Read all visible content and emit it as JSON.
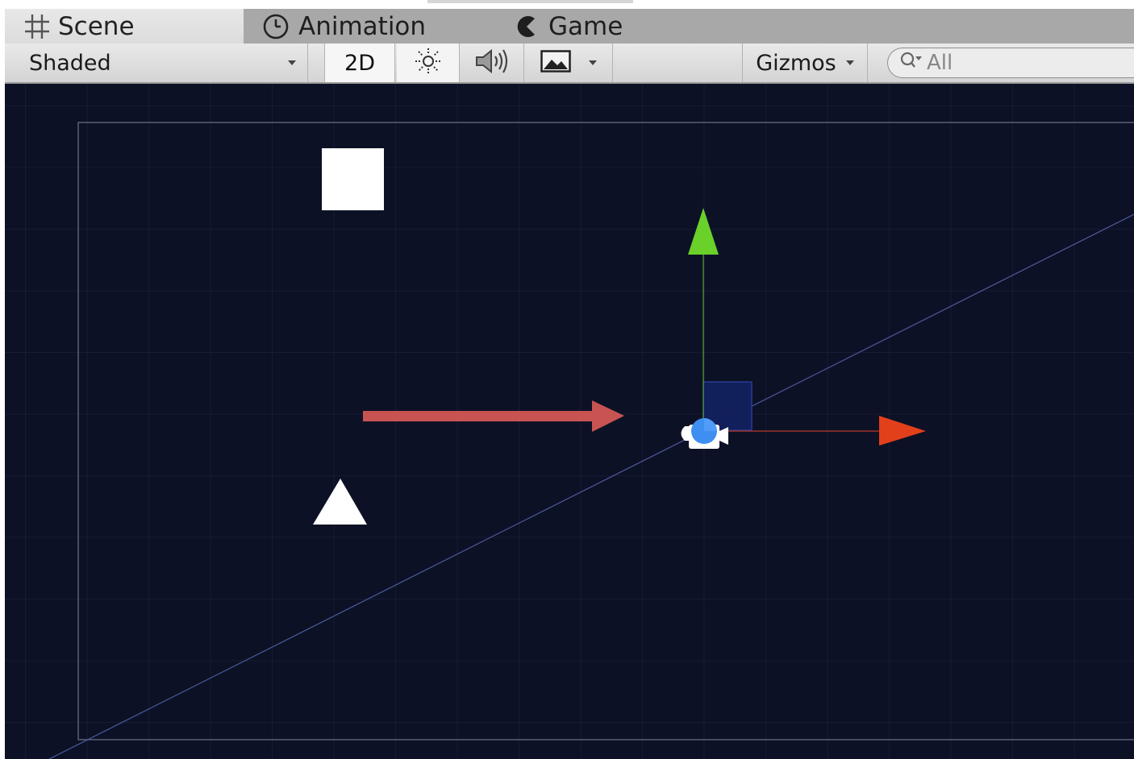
{
  "top_strip": {},
  "tabs": [
    {
      "label": "Scene",
      "icon": "grid-icon",
      "active": true
    },
    {
      "label": "Animation",
      "icon": "clock-icon",
      "active": false
    },
    {
      "label": "Game",
      "icon": "pacman-icon",
      "active": false
    }
  ],
  "toolbar": {
    "draw_mode": "Shaded",
    "toggle_2d": "2D",
    "lighting_icon": "sun-icon",
    "audio_icon": "speaker-icon",
    "effects_icon": "image-icon",
    "gizmos": "Gizmos",
    "search_placeholder": "All"
  },
  "scene": {
    "background": "#0d1126",
    "objects": [
      "white-square",
      "white-triangle",
      "camera",
      "move-gizmo",
      "annotation-arrow"
    ],
    "colors": {
      "gizmo_y": "#6ad12a",
      "gizmo_x": "#e2401a",
      "gizmo_plane": "#12205e",
      "annotation_arrow": "#c85353",
      "camera_sphere": "#3f8ef2"
    }
  }
}
